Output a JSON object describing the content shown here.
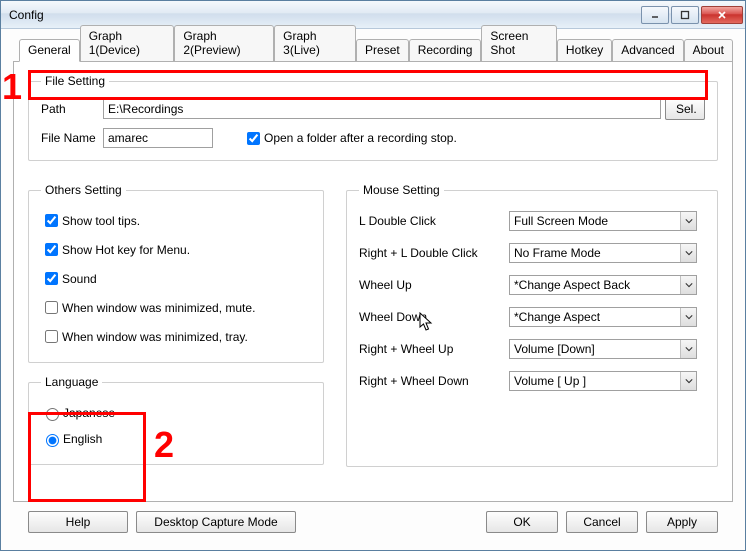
{
  "window": {
    "title": "Config"
  },
  "tabs": [
    "General",
    "Graph 1(Device)",
    "Graph 2(Preview)",
    "Graph 3(Live)",
    "Preset",
    "Recording",
    "Screen Shot",
    "Hotkey",
    "Advanced",
    "About"
  ],
  "file_setting": {
    "legend": "File Setting",
    "path_label": "Path",
    "path_value": "E:\\Recordings",
    "sel_label": "Sel.",
    "filename_label": "File Name",
    "filename_value": "amarec",
    "open_folder_label": "Open a folder after a recording stop."
  },
  "others": {
    "legend": "Others Setting",
    "tooltips": "Show tool tips.",
    "hotkey": "Show Hot key for Menu.",
    "sound": "Sound",
    "min_mute": "When window was minimized, mute.",
    "min_tray": "When window was minimized, tray."
  },
  "language": {
    "legend": "Language",
    "jp": "Japanese",
    "en": "English"
  },
  "mouse": {
    "legend": "Mouse Setting",
    "rows": [
      {
        "label": "L Double Click",
        "value": "Full Screen Mode"
      },
      {
        "label": "Right + L Double Click",
        "value": "No Frame Mode"
      },
      {
        "label": "Wheel Up",
        "value": "*Change Aspect Back"
      },
      {
        "label": "Wheel Down",
        "value": "*Change Aspect"
      },
      {
        "label": "Right + Wheel Up",
        "value": "Volume [Down]"
      },
      {
        "label": "Right + Wheel Down",
        "value": "Volume [ Up ]"
      }
    ]
  },
  "buttons": {
    "help": "Help",
    "desktop": "Desktop Capture Mode",
    "ok": "OK",
    "cancel": "Cancel",
    "apply": "Apply"
  },
  "annotations": {
    "one": "1",
    "two": "2"
  }
}
